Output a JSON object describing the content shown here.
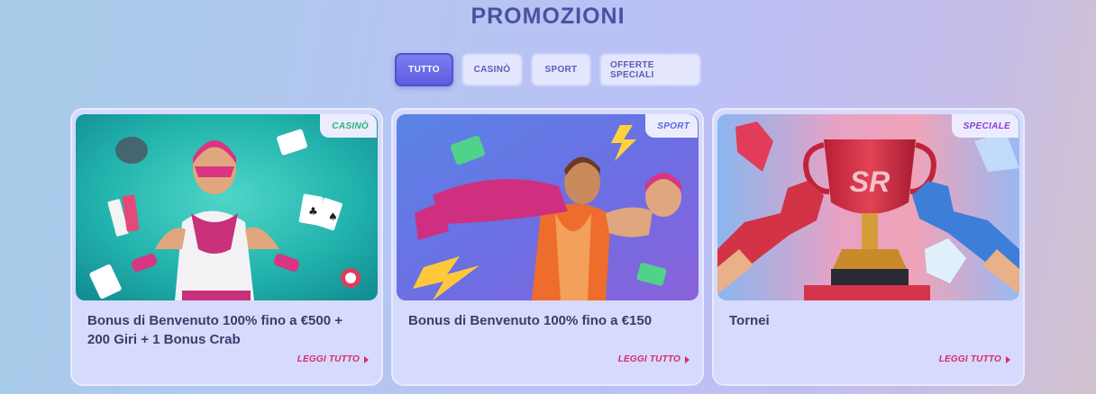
{
  "header": {
    "title": "PROMOZIONI"
  },
  "filters": [
    {
      "label": "TUTTO",
      "active": true
    },
    {
      "label": "CASINÒ",
      "active": false
    },
    {
      "label": "SPORT",
      "active": false
    },
    {
      "label": "OFFERTE SPECIALI",
      "active": false
    }
  ],
  "cards": [
    {
      "tag": "CASINÒ",
      "title": "Bonus di Benvenuto 100% fino a €500 + 200 Giri + 1 Bonus Crab",
      "cta": "LEGGI TUTTO"
    },
    {
      "tag": "SPORT",
      "title": "Bonus di Benvenuto 100% fino a €150",
      "cta": "LEGGI TUTTO"
    },
    {
      "tag": "SPECIALE",
      "title": "Tornei",
      "cta": "LEGGI TUTTO",
      "trophy_text": "SR"
    }
  ]
}
